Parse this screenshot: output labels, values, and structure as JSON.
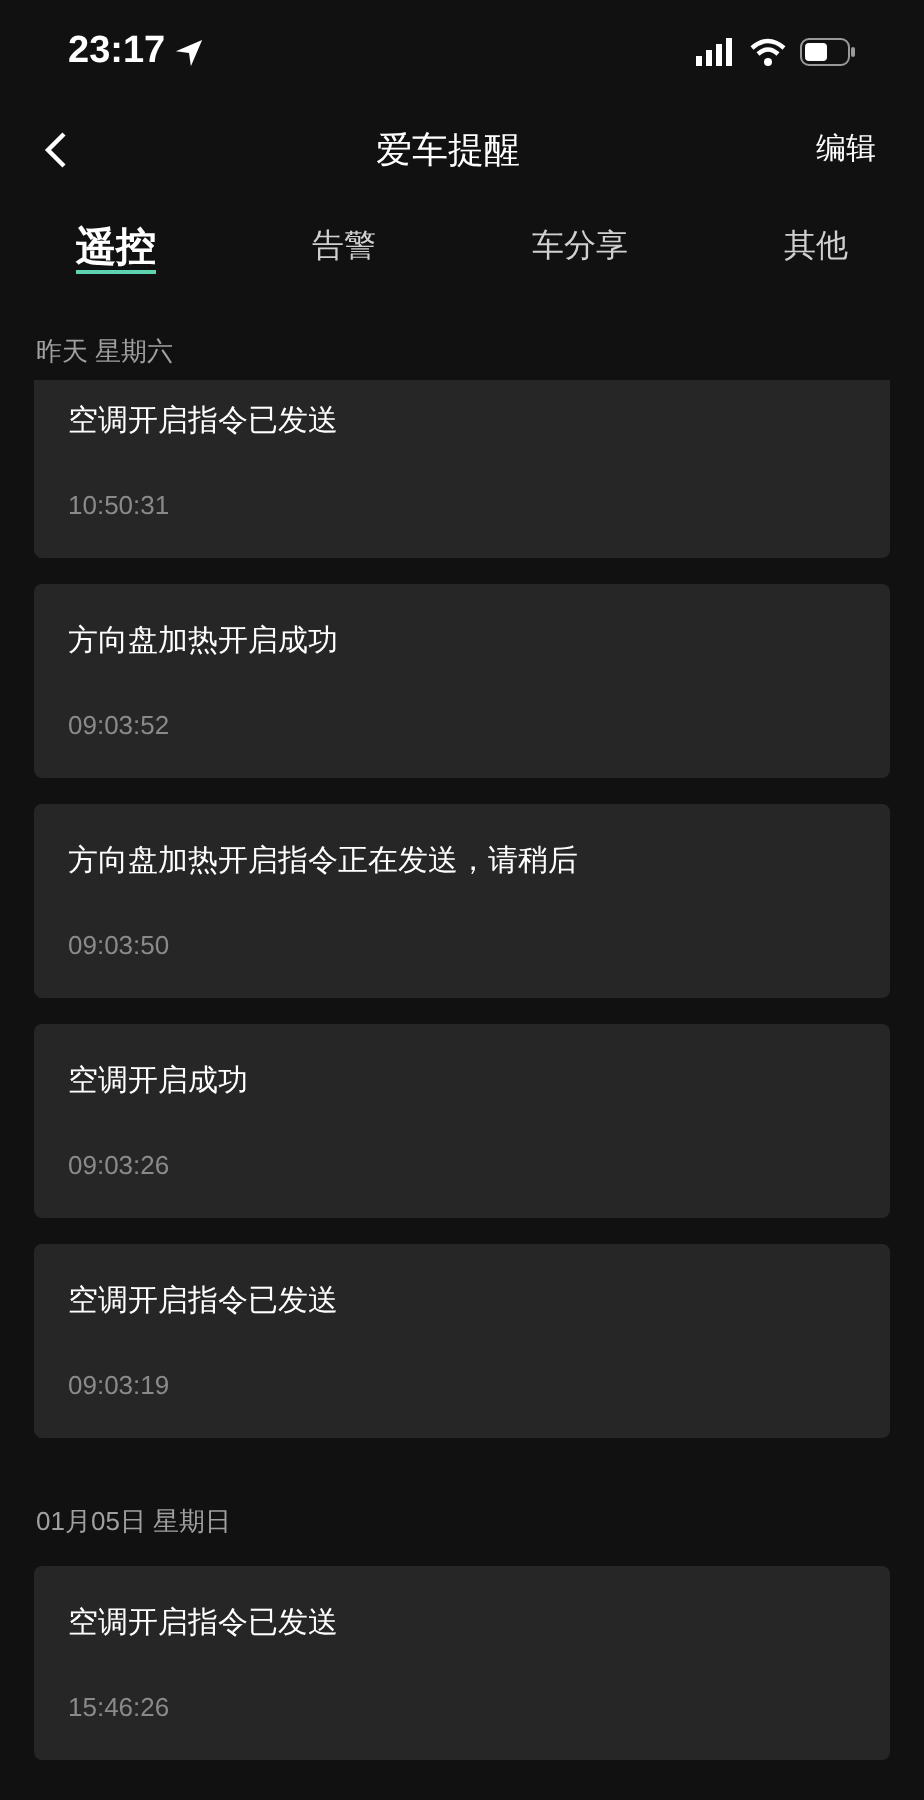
{
  "status_bar": {
    "time": "23:17"
  },
  "nav": {
    "title": "爱车提醒",
    "action": "编辑"
  },
  "tabs": [
    {
      "label": "遥控",
      "selected": true
    },
    {
      "label": "告警",
      "selected": false
    },
    {
      "label": "车分享",
      "selected": false
    },
    {
      "label": "其他",
      "selected": false
    }
  ],
  "groups": [
    {
      "date": "昨天 星期六",
      "items": [
        {
          "message": "空调开启指令已发送",
          "time": "10:50:31",
          "cut": true
        },
        {
          "message": "方向盘加热开启成功",
          "time": "09:03:52",
          "cut": false
        },
        {
          "message": "方向盘加热开启指令正在发送，请稍后",
          "time": "09:03:50",
          "cut": false
        },
        {
          "message": "空调开启成功",
          "time": "09:03:26",
          "cut": false
        },
        {
          "message": "空调开启指令已发送",
          "time": "09:03:19",
          "cut": false
        }
      ]
    },
    {
      "date": "01月05日 星期日",
      "items": [
        {
          "message": "空调开启指令已发送",
          "time": "15:46:26",
          "cut": false
        }
      ]
    }
  ]
}
